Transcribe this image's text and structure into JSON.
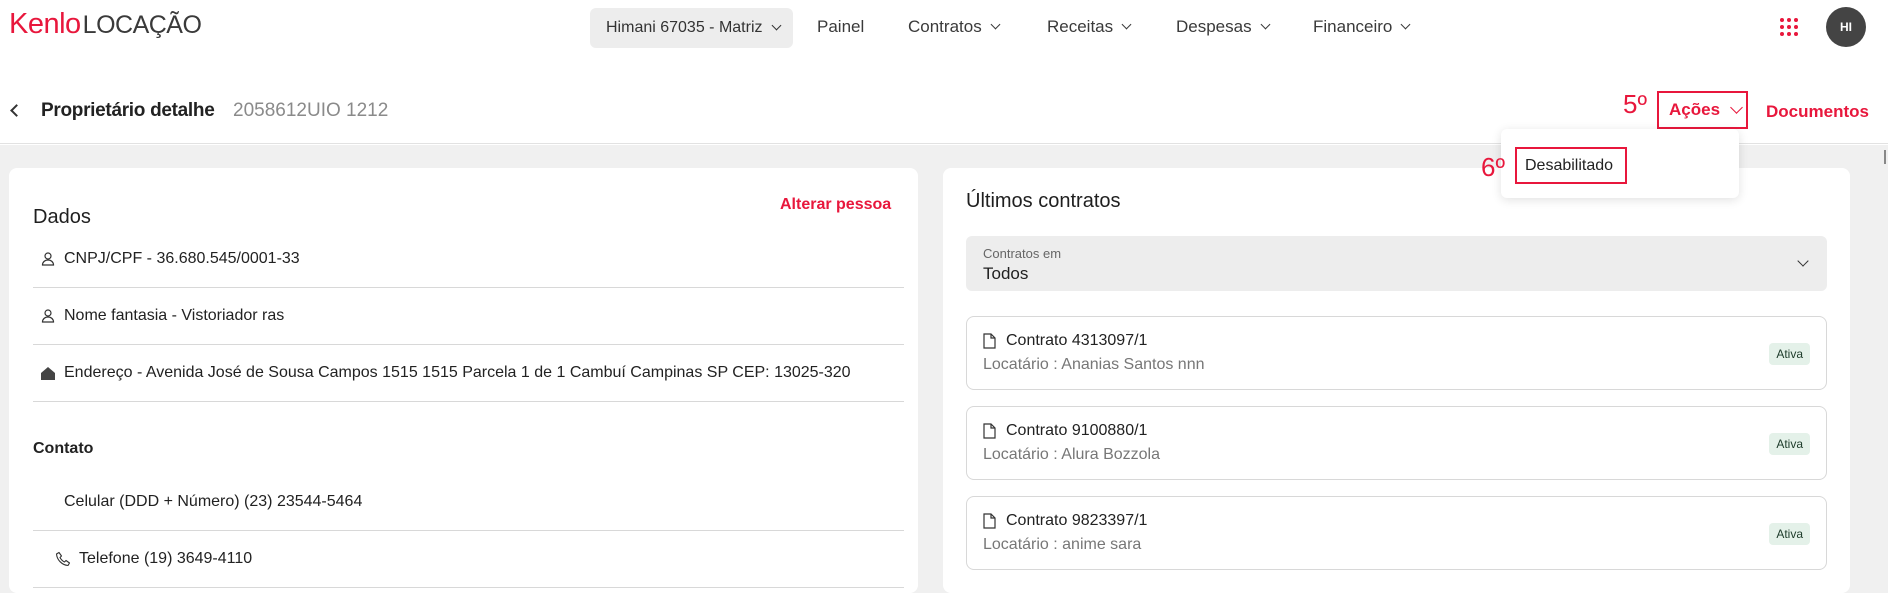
{
  "header": {
    "logo_brand": "Kenlo",
    "logo_product": "LOCAÇÃO",
    "branch_selector": "Himani 67035 - Matriz",
    "nav": [
      "Painel",
      "Contratos",
      "Receitas",
      "Despesas",
      "Financeiro"
    ],
    "avatar_initials": "HI",
    "accent_color": "#e8173c"
  },
  "subheader": {
    "title": "Proprietário detalhe",
    "id": "2058612UIO 1212",
    "step_acoes": "5º",
    "acoes_label": "Ações",
    "documentos_label": "Documentos"
  },
  "dropdown": {
    "step": "6º",
    "items": [
      "Desabilitado"
    ]
  },
  "dados": {
    "title": "Dados",
    "alterar_label": "Alterar pessoa",
    "rows": [
      {
        "icon": "person-icon",
        "text": "CNPJ/CPF - 36.680.545/0001-33"
      },
      {
        "icon": "person-icon",
        "text": "Nome fantasia - Vistoriador ras"
      },
      {
        "icon": "home-icon",
        "text": "Endereço - Avenida José de Sousa Campos 1515 1515 Parcela 1 de 1 Cambuí Campinas SP CEP: 13025-320"
      }
    ],
    "contato_label": "Contato",
    "contato_rows": [
      {
        "icon": "",
        "text": "Celular (DDD + Número) (23) 23544-5464"
      },
      {
        "icon": "phone-icon",
        "text": "Telefone (19) 3649-4110"
      }
    ]
  },
  "contratos": {
    "title": "Últimos contratos",
    "filter_label": "Contratos em",
    "filter_value": "Todos",
    "items": [
      {
        "title": "Contrato 4313097/1",
        "sub": "Locatário : Ananias Santos nnn",
        "status": "Ativa"
      },
      {
        "title": "Contrato 9100880/1",
        "sub": "Locatário : Alura Bozzola",
        "status": "Ativa"
      },
      {
        "title": "Contrato 9823397/1",
        "sub": "Locatário : anime sara",
        "status": "Ativa"
      }
    ]
  }
}
